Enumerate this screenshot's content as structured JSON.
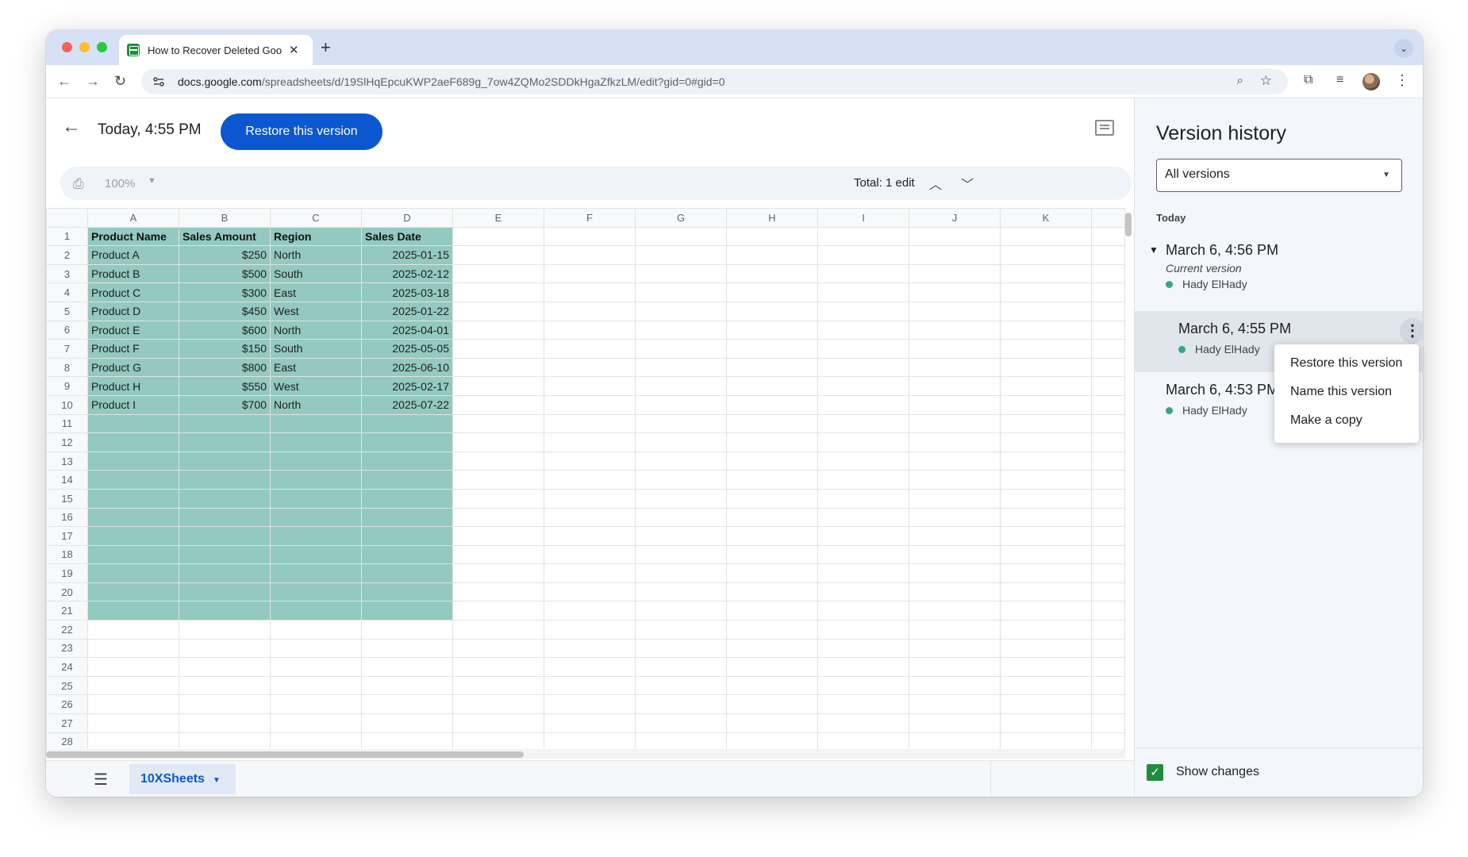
{
  "browser": {
    "tab_title": "How to Recover Deleted Goo",
    "url_host": "docs.google.com",
    "url_path": "/spreadsheets/d/19SlHqEpcuKWP2aeF689g_7ow4ZQMo2SDDkHgaZfkzLM/edit?gid=0#gid=0"
  },
  "header": {
    "title": "Today, 4:55 PM",
    "restore_label": "Restore this version"
  },
  "sheet_toolbar": {
    "zoom": "100%",
    "edits": "Total: 1 edit"
  },
  "grid": {
    "columns": [
      "A",
      "B",
      "C",
      "D",
      "E",
      "F",
      "G",
      "H",
      "I",
      "J",
      "K"
    ],
    "highlight_rows": 21,
    "highlight_cols": 4,
    "total_rows": 28,
    "rows": [
      [
        "Product Name",
        "Sales Amount",
        "Region",
        "Sales Date"
      ],
      [
        "Product A",
        "$250",
        "North",
        "2025-01-15"
      ],
      [
        "Product B",
        "$500",
        "South",
        "2025-02-12"
      ],
      [
        "Product C",
        "$300",
        "East",
        "2025-03-18"
      ],
      [
        "Product D",
        "$450",
        "West",
        "2025-01-22"
      ],
      [
        "Product E",
        "$600",
        "North",
        "2025-04-01"
      ],
      [
        "Product F",
        "$150",
        "South",
        "2025-05-05"
      ],
      [
        "Product G",
        "$800",
        "East",
        "2025-06-10"
      ],
      [
        "Product H",
        "$550",
        "West",
        "2025-02-17"
      ],
      [
        "Product I",
        "$700",
        "North",
        "2025-07-22"
      ]
    ]
  },
  "sheetbar": {
    "sheet_name": "10XSheets"
  },
  "panel": {
    "title": "Version history",
    "filter": "All versions",
    "group": "Today",
    "versions": [
      {
        "time": "March 6, 4:56 PM",
        "sub": "Current version",
        "author": "Hady ElHady"
      },
      {
        "time": "March 6, 4:55 PM",
        "author": "Hady ElHady"
      },
      {
        "time": "March 6, 4:53 PM",
        "author": "Hady ElHady"
      }
    ],
    "menu": [
      "Restore this version",
      "Name this version",
      "Make a copy"
    ],
    "show_changes": "Show changes"
  },
  "colors": {
    "accent": "#0b57d0",
    "highlight": "#93c9c0",
    "author_dot": "#34a68f"
  }
}
